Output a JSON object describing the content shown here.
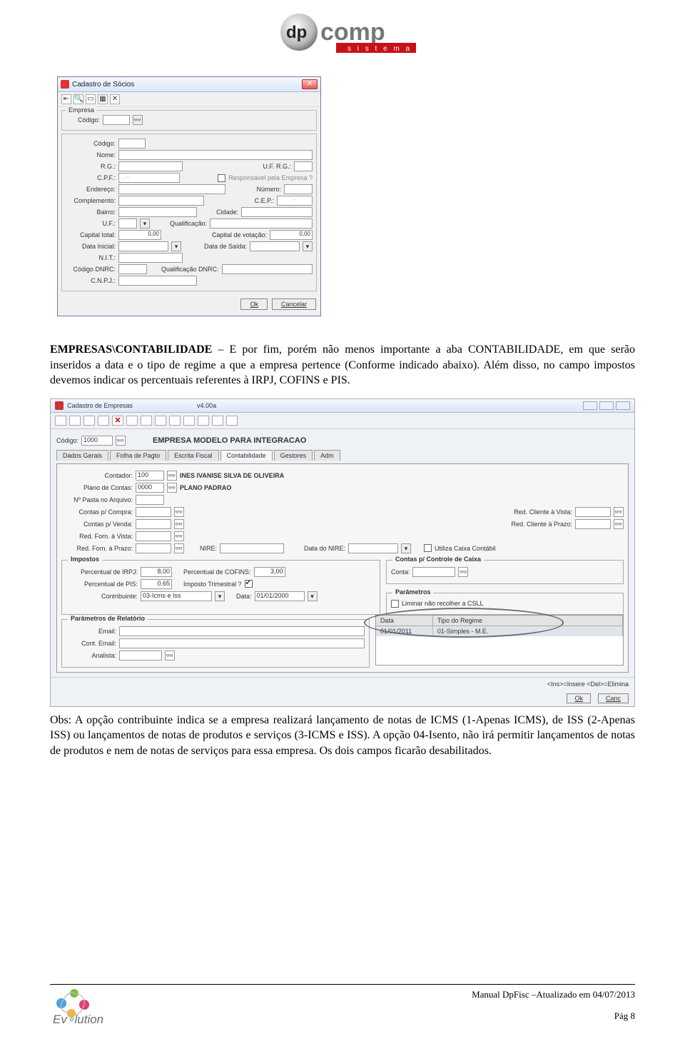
{
  "header": {
    "brand": "dp",
    "brand2": "comp",
    "tag": "s i s t e m a s"
  },
  "dialog1": {
    "title": "Cadastro de Sócios",
    "group_empresa": "Empresa",
    "labels": {
      "codigo_empresa": "Código:",
      "codigo": "Código:",
      "nome": "Nome:",
      "rg": "R.G.:",
      "uf_rg": "U.F. R.G.:",
      "cpf": "C.P.F.:",
      "resp": "Responsável pela Empresa ?",
      "endereco": "Endereço:",
      "numero": "Número:",
      "complemento": "Complemento:",
      "cep": "C.E.P.:",
      "bairro": "Bairro:",
      "cidade": "Cidade:",
      "uf": "U.F.:",
      "qualificacao": "Qualificação:",
      "capital_total": "Capital total:",
      "capital_votacao": "Capital de votação:",
      "data_inicial": "Data Inicial:",
      "data_saida": "Data de Saída:",
      "nit": "N.I.T.:",
      "codigo_dnrc": "Código DNRC:",
      "qualif_dnrc": "Qualificação DNRC:",
      "cnpj": "C.N.P.J.:"
    },
    "values": {
      "cpf": ". .  -",
      "cep": "-",
      "capital_total": "0,00",
      "capital_votacao": "0,00"
    },
    "buttons": {
      "ok": "Ok",
      "cancel": "Cancelar"
    }
  },
  "paragraph1": {
    "bold": "EMPRESAS\\CONTABILIDADE",
    "text": " – E por fim, porém não menos importante a aba CONTABILIDADE, em que serão inseridos a data e o tipo de regime a que a empresa pertence (Conforme indicado abaixo). Além disso, no campo impostos devemos indicar os percentuais referentes à IRPJ, COFINS e PIS."
  },
  "shot2": {
    "title": "Cadastro de Empresas",
    "version": "v4.00a",
    "codigo_label": "Código:",
    "codigo_value": "1000",
    "company_name": "EMPRESA MODELO PARA INTEGRACAO",
    "tabs": [
      "Dados Gerais",
      "Folha de Pagto",
      "Escrita Fiscal",
      "Contabilidade",
      "Gestores",
      "Adm"
    ],
    "contador_label": "Contador:",
    "contador_value": "100",
    "contador_name": "INES IVANISE SILVA DE OLIVEIRA",
    "plano_label": "Plano de Contas:",
    "plano_value": "0000",
    "plano_name": "PLANO PADRAO",
    "pasta_label": "Nº Pasta no Arquivo:",
    "contas_compra": "Contas p/ Compra:",
    "contas_venda": "Contas p/ Venda:",
    "red_vista": "Red. Forn. à Vista:",
    "red_prazo": "Red. Forn. à Prazo:",
    "red_cli_vista": "Red. Cliente à Vista:",
    "red_cli_prazo": "Red. Cliente à Prazo:",
    "nire": "NIRE:",
    "data_nire": "Data do NIRE:",
    "caixa": "Utiliza Caixa Contábil",
    "impostos_legend": "Impostos",
    "perc_irpj": "Percentual de IRPJ:",
    "perc_irpj_v": "8,00",
    "perc_cofins": "Percentual de COFINS:",
    "perc_cofins_v": "3,00",
    "perc_pis": "Percentual de PIS:",
    "perc_pis_v": "0,65",
    "imp_trim": "Imposto Trimestral ?",
    "contribuinte": "Contribuinte:",
    "contribuinte_v": "03-Icms e Iss",
    "data_label": "Data:",
    "data_v": "01/01/2000",
    "contas_caixa_legend": "Contas p/ Controle de Caixa",
    "conta": "Conta:",
    "param_legend": "Parâmetros",
    "liminar": "Liminar não recolher a CSLL",
    "rel_legend": "Parâmetros de Relatório",
    "email": "Email:",
    "cont_email": "Cont. Email:",
    "analista": "Analista:",
    "grid": {
      "h1": "Data",
      "h2": "Tipo do Regime",
      "r1c1": "01/01/2011",
      "r1c2": "01-Simples - M.E."
    },
    "footer_hint": "<Ins>=Insere <Del>=Elimina",
    "ok": "Ok",
    "cancel": "Canc"
  },
  "obs": "Obs: A opção contribuinte indica se a empresa realizará lançamento de notas de ICMS (1-Apenas ICMS), de ISS (2-Apenas ISS) ou lançamentos de notas de produtos e serviços (3-ICMS e ISS). A opção 04-Isento, não irá permitir lançamentos de notas de produtos e nem de notas de serviços para essa empresa. Os dois campos ficarão desabilitados.",
  "footer": {
    "line1": "Manual DpFisc –Atualizado em  04/07/2013",
    "page": "Pág 8"
  }
}
